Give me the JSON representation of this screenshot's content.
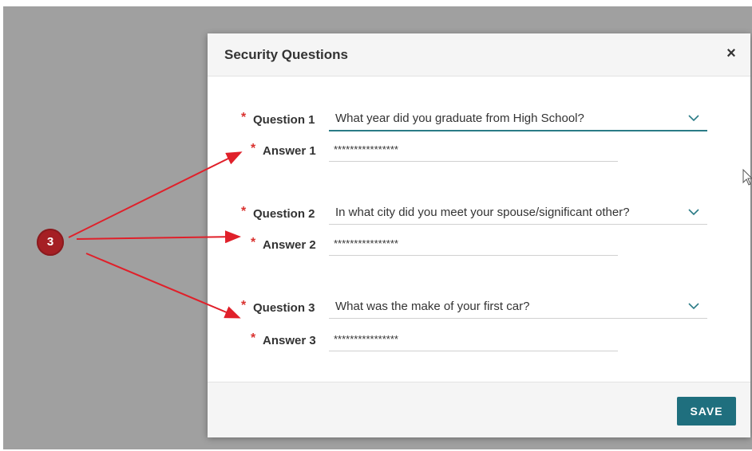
{
  "dialog": {
    "title": "Security Questions",
    "close_glyph": "×",
    "save_label": "SAVE"
  },
  "fields": [
    {
      "question_label": "Question 1",
      "question_value": "What year did you graduate from High School?",
      "answer_label": "Answer 1",
      "answer_value": "****************"
    },
    {
      "question_label": "Question 2",
      "question_value": "In what city did you meet your spouse/significant other?",
      "answer_label": "Answer 2",
      "answer_value": "****************"
    },
    {
      "question_label": "Question 3",
      "question_value": "What was the make of your first car?",
      "answer_label": "Answer 3",
      "answer_value": "****************"
    }
  ],
  "required_marker": "*",
  "callout": {
    "number": "3"
  },
  "icons": [
    "close-icon",
    "chevron-down-icon",
    "mouse-cursor-icon"
  ],
  "colors": {
    "accent": "#1f6f7e",
    "required": "#d9322f",
    "callout": "#a51f24",
    "arrow": "#e0202a"
  }
}
